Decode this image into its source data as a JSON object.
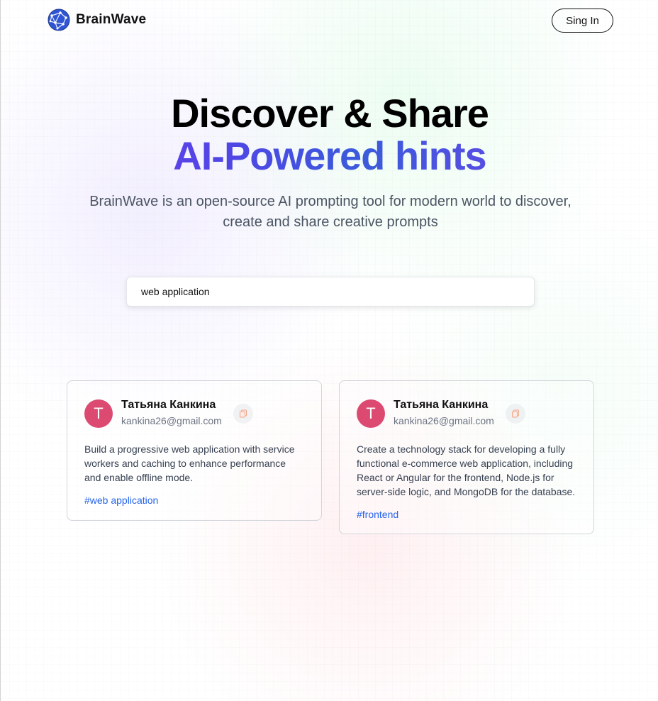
{
  "app": {
    "name": "BrainWave"
  },
  "header": {
    "signin_label": "Sing In"
  },
  "hero": {
    "title_line1": "Discover & Share",
    "title_line2": "AI-Powered hints",
    "subtitle": "BrainWave is an open-source AI prompting tool for modern world to discover, create and share creative prompts"
  },
  "search": {
    "value": "web application"
  },
  "colors": {
    "avatar": "#dc4a72",
    "tag": "#2563eb",
    "gradient_start": "#7c3aed",
    "gradient_mid": "#4f46e5"
  },
  "cards": [
    {
      "avatar_letter": "T",
      "username": "Татьяна Канкина",
      "email": "kankina26@gmail.com",
      "prompt": "Build a progressive web application with service workers and caching to enhance performance and enable offline mode.",
      "tag": "#web application",
      "copy_icon": "copy-icon"
    },
    {
      "avatar_letter": "T",
      "username": "Татьяна Канкина",
      "email": "kankina26@gmail.com",
      "prompt": "Create a technology stack for developing a fully functional e-commerce web application, including React or Angular for the frontend, Node.js for server-side logic, and MongoDB for the database.",
      "tag": "#frontend",
      "copy_icon": "copy-icon"
    }
  ]
}
